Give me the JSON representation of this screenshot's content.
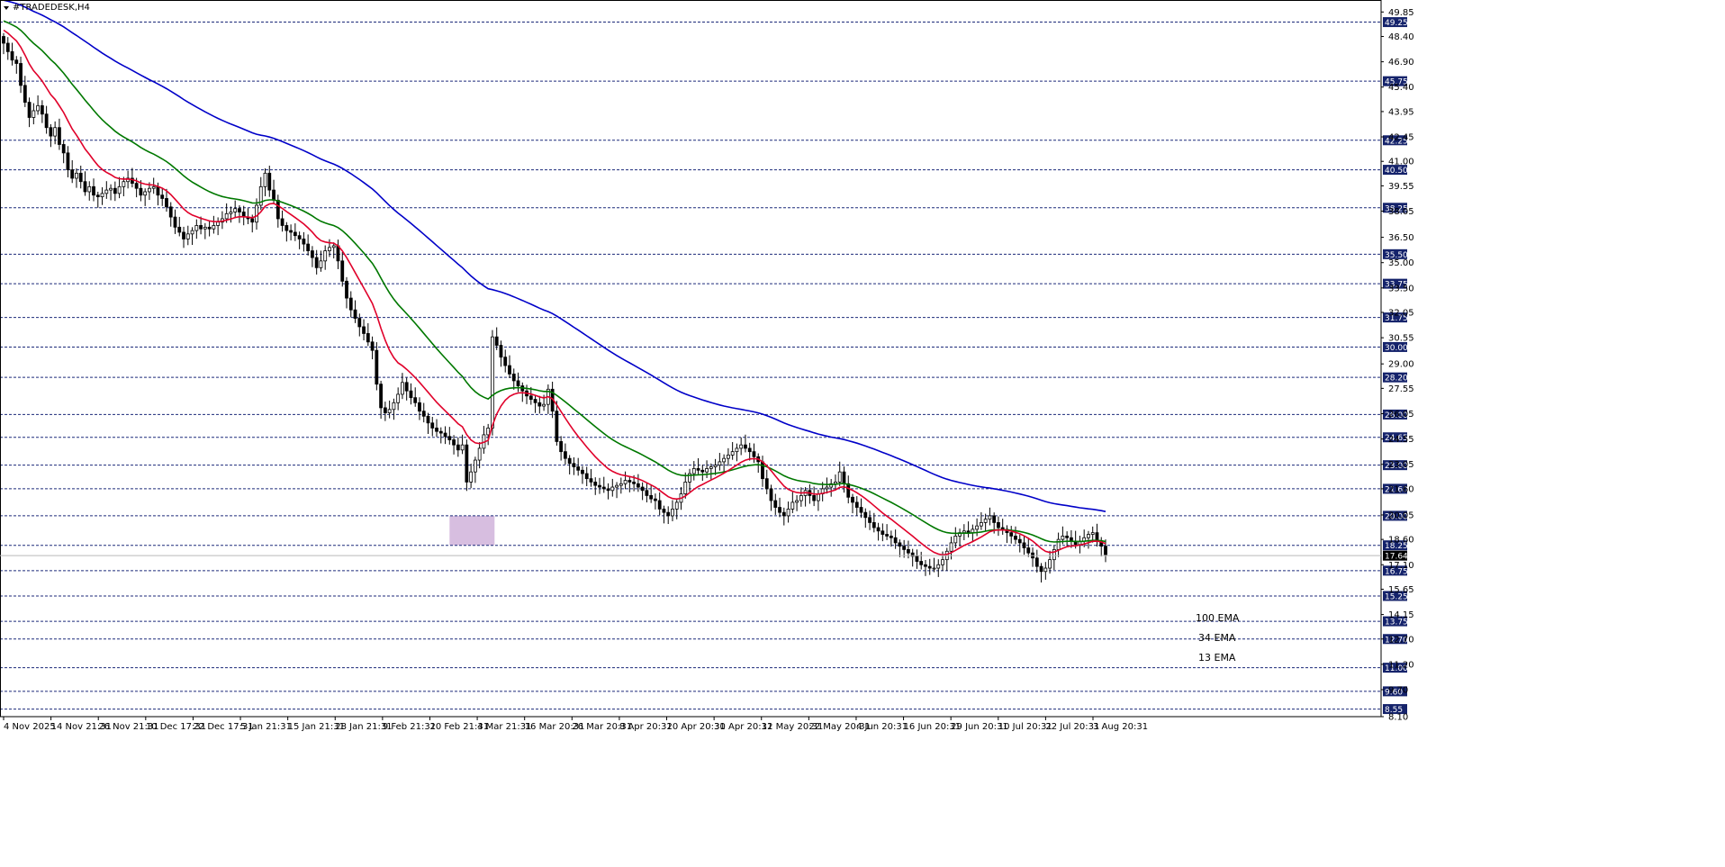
{
  "title": "#TRADEDESK,H4",
  "labels": {
    "ema100": "100 EMA",
    "ema34": "34 EMA",
    "ema13": "13 EMA"
  },
  "colors": {
    "ema100": "#0000c8",
    "ema34": "#007800",
    "ema13": "#e0002a",
    "level_line": "#1c2a7a",
    "level_badge": "#15236b",
    "zone": "#c9a8d6",
    "current_badge": "#000000"
  },
  "chart_data": {
    "type": "candlestick",
    "title": "#TRADEDESK,H4",
    "ylim": [
      8.1,
      50.4
    ],
    "x_ticks": [
      "4 Nov 2025",
      "14 Nov 21:31",
      "26 Nov 21:31",
      "10 Dec 17:31",
      "22 Dec 17:31",
      "5 Jan 21:31",
      "15 Jan 21:31",
      "28 Jan 21:31",
      "9 Feb 21:31",
      "20 Feb 21:31",
      "4 Mar 21:31",
      "16 Mar 20:31",
      "26 Mar 20:31",
      "8 Apr 20:31",
      "20 Apr 20:31",
      "30 Apr 20:31",
      "12 May 20:31",
      "22 May 20:31",
      "4 Jun 20:31",
      "16 Jun 20:31",
      "29 Jun 20:31",
      "10 Jul 20:31",
      "22 Jul 20:31",
      "3 Aug 20:31"
    ],
    "y_ticks": [
      "49.85",
      "48.40",
      "46.90",
      "45.40",
      "43.95",
      "42.45",
      "41.00",
      "39.55",
      "38.05",
      "36.50",
      "35.00",
      "33.50",
      "32.05",
      "30.55",
      "29.00",
      "27.55",
      "26.05",
      "24.55",
      "23.05",
      "21.60",
      "20.05",
      "18.60",
      "17.10",
      "15.65",
      "14.15",
      "12.70",
      "11.20",
      "9.70",
      "8.10"
    ],
    "levels": [
      "49.25",
      "45.75",
      "42.25",
      "40.50",
      "38.25",
      "35.50",
      "33.75",
      "31.75",
      "30.00",
      "28.20",
      "26.00",
      "24.65",
      "23.00",
      "21.60",
      "20.00",
      "18.25",
      "16.75",
      "15.25",
      "13.75",
      "12.70",
      "11.00",
      "9.60",
      "8.55"
    ],
    "current_price": "17.64",
    "zone": {
      "x_start": 104,
      "x_end": 114.5,
      "y_top": 20.0,
      "y_bottom": 18.25
    },
    "closes": [
      48.0,
      47.5,
      47.0,
      46.8,
      45.5,
      44.5,
      43.6,
      44.0,
      44.3,
      43.8,
      43.0,
      42.5,
      43.0,
      42.0,
      41.5,
      40.5,
      40.0,
      40.3,
      39.8,
      39.2,
      39.5,
      39.0,
      38.9,
      39.1,
      39.3,
      39.4,
      39.1,
      39.5,
      39.8,
      40.0,
      39.7,
      39.4,
      39.0,
      39.2,
      39.4,
      39.5,
      39.0,
      38.8,
      38.3,
      37.7,
      37.1,
      36.8,
      36.4,
      36.7,
      36.9,
      37.2,
      37.0,
      37.1,
      37.0,
      37.2,
      37.4,
      37.6,
      37.9,
      38.0,
      38.2,
      38.0,
      37.7,
      37.6,
      37.4,
      38.4,
      39.5,
      40.3,
      39.3,
      38.7,
      37.6,
      37.2,
      36.9,
      36.8,
      36.6,
      36.4,
      36.1,
      35.7,
      35.3,
      34.7,
      35.1,
      35.7,
      35.9,
      36.0,
      35.1,
      33.9,
      32.9,
      32.2,
      31.7,
      31.2,
      30.8,
      30.3,
      29.8,
      27.8,
      26.4,
      26.1,
      26.3,
      26.7,
      27.2,
      27.9,
      27.4,
      27.0,
      26.7,
      26.2,
      25.9,
      25.5,
      25.2,
      25.0,
      24.9,
      24.7,
      24.5,
      24.2,
      23.9,
      24.2,
      22.0,
      22.6,
      23.3,
      24.0,
      24.8,
      25.2,
      30.6,
      30.1,
      29.4,
      28.9,
      28.4,
      28.0,
      27.7,
      27.4,
      27.1,
      26.9,
      26.7,
      26.5,
      26.6,
      27.5,
      26.2,
      24.4,
      23.8,
      23.4,
      23.1,
      22.9,
      22.7,
      22.5,
      22.2,
      22.0,
      21.8,
      21.7,
      21.6,
      21.5,
      21.7,
      21.8,
      21.9,
      22.1,
      22.0,
      21.9,
      21.7,
      21.5,
      21.2,
      21.0,
      20.9,
      20.4,
      20.2,
      20.0,
      20.4,
      20.8,
      21.3,
      22.0,
      22.5,
      22.8,
      22.7,
      22.6,
      22.8,
      22.9,
      23.0,
      23.2,
      23.4,
      23.6,
      23.8,
      24.0,
      24.2,
      24.0,
      23.8,
      23.5,
      23.2,
      22.2,
      21.6,
      20.9,
      20.5,
      20.2,
      20.0,
      20.4,
      20.8,
      20.9,
      21.2,
      21.5,
      21.2,
      20.9,
      21.3,
      21.6,
      21.7,
      21.9,
      22.0,
      22.6,
      21.9,
      21.1,
      20.8,
      20.5,
      20.2,
      19.9,
      19.6,
      19.3,
      19.1,
      18.9,
      18.8,
      18.7,
      18.4,
      18.2,
      18.0,
      17.8,
      17.6,
      17.3,
      17.1,
      17.0,
      16.9,
      16.9,
      17.1,
      17.4,
      17.9,
      18.4,
      18.8,
      19.0,
      19.1,
      19.0,
      19.2,
      19.4,
      19.6,
      19.8,
      20.0,
      19.6,
      19.3,
      19.2,
      19.0,
      18.8,
      18.6,
      18.4,
      18.1,
      17.8,
      17.5,
      17.0,
      16.7,
      16.9,
      17.4,
      18.0,
      18.6,
      18.8,
      18.7,
      18.5,
      18.3,
      18.5,
      18.7,
      18.9,
      19.0,
      18.5,
      18.2,
      17.7
    ]
  }
}
